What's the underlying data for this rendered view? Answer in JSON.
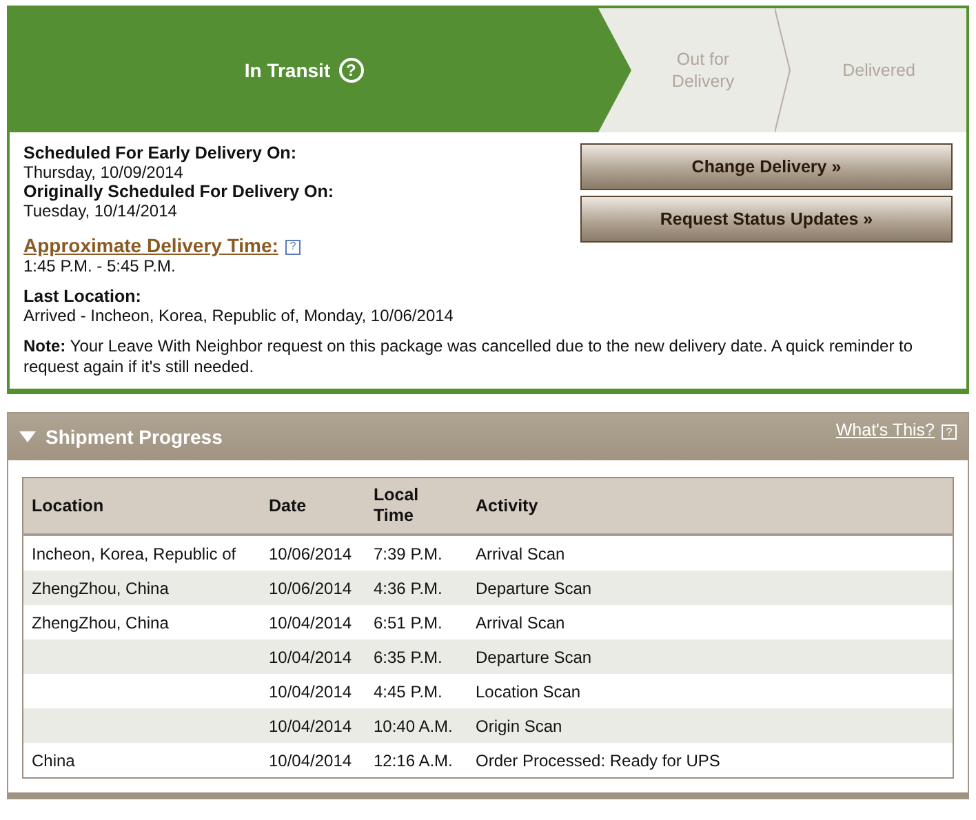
{
  "progress": {
    "steps": [
      {
        "label": "In Transit",
        "help": "?",
        "selected": true
      },
      {
        "label": "Out for Delivery",
        "selected": false
      },
      {
        "label": "Delivered",
        "selected": false
      }
    ]
  },
  "details": {
    "scheduled": [
      {
        "label": "Scheduled For Early Delivery On:",
        "value": "Thursday, 10/09/2014"
      },
      {
        "label": "Originally Scheduled For Delivery On:",
        "value": "Tuesday, 10/14/2014"
      }
    ],
    "approx": {
      "label": "Approximate Delivery Time:",
      "help": "?",
      "value": "1:45 P.M. - 5:45 P.M."
    },
    "last_location": {
      "label": "Last Location:",
      "value": "Arrived - Incheon, Korea, Republic of, Monday, 10/06/2014"
    },
    "note": "**Note:** Your Leave With Neighbor request on this package was cancelled due to the new delivery date. A quick reminder to request again if it's still needed.",
    "buttons": [
      "Change Delivery »",
      "Request Status Updates »"
    ]
  },
  "shipment_progress": {
    "title": "Shipment Progress",
    "expanded": true,
    "link": "What's This?",
    "help": "?",
    "table": {
      "columns": [
        "Location",
        "Date",
        "Local Time",
        "Activity"
      ],
      "rows": [
        [
          "Incheon, Korea, Republic of",
          "10/06/2014",
          "7:39 P.M.",
          "Arrival Scan"
        ],
        [
          "ZhengZhou, China",
          "10/06/2014",
          "4:36 P.M.",
          "Departure Scan"
        ],
        [
          "ZhengZhou, China",
          "10/04/2014",
          "6:51 P.M.",
          "Arrival Scan"
        ],
        [
          "",
          "10/04/2014",
          "6:35 P.M.",
          "Departure Scan"
        ],
        [
          "",
          "10/04/2014",
          "4:45 P.M.",
          "Location Scan"
        ],
        [
          "",
          "10/04/2014",
          "10:40 A.M.",
          "Origin Scan"
        ],
        [
          "China",
          "10/04/2014",
          "12:16 A.M.",
          "Order Processed: Ready for UPS"
        ]
      ]
    }
  }
}
